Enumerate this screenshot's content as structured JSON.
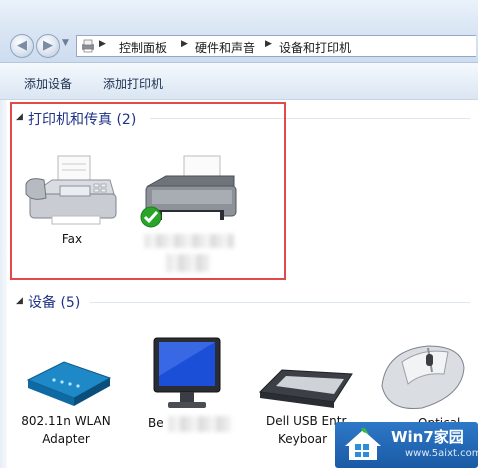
{
  "breadcrumb": {
    "items": [
      "控制面板",
      "硬件和声音",
      "设备和打印机"
    ]
  },
  "toolbar": {
    "add_device": "添加设备",
    "add_printer": "添加打印机"
  },
  "printers_group": {
    "title": "打印机和传真 (2)",
    "items": [
      {
        "label": "Fax",
        "icon": "fax-machine-icon"
      },
      {
        "label": "",
        "icon": "printer-icon",
        "status": "default-printer-check"
      }
    ]
  },
  "devices_group": {
    "title": "设备 (5)",
    "items": [
      {
        "label_line1": "802.11n WLAN",
        "label_line2": "Adapter",
        "icon": "wlan-adapter-icon"
      },
      {
        "label_line1": "Be",
        "label_line2": "",
        "icon": "monitor-icon"
      },
      {
        "label_line1": "Dell USB Entr",
        "label_line2": "Keyboar",
        "icon": "keyboard-icon"
      },
      {
        "label_line1": "Optical",
        "label_line2": "",
        "icon": "mouse-icon"
      }
    ]
  },
  "watermark": {
    "title": "Win7家园",
    "url": "www.5aixt.com"
  },
  "colors": {
    "group_title": "#1e3287",
    "highlight_border": "#e24a4a",
    "check_green": "#2aa52a"
  }
}
